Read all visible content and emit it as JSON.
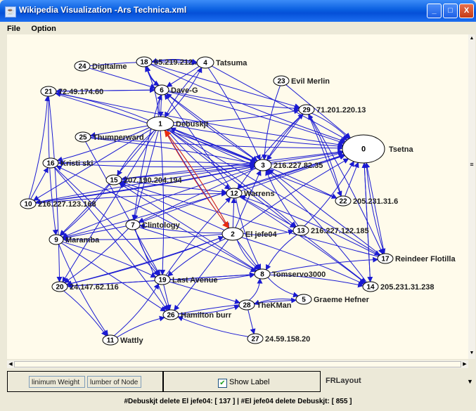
{
  "window": {
    "title": "Wikipedia Visualization -Ars Technica.xml",
    "minimize": "_",
    "maximize": "□",
    "close": "X"
  },
  "menu": [
    {
      "label": "File"
    },
    {
      "label": "Option"
    }
  ],
  "colors": {
    "edge": "#1a1ad2",
    "highlight_edge": "#e82c0e",
    "canvas": "#fffbeb"
  },
  "graph": {
    "nodes": [
      {
        "id": "0",
        "label": "Tsetna"
      },
      {
        "id": "1",
        "label": "Debuskjt"
      },
      {
        "id": "2",
        "label": "El jefe04"
      },
      {
        "id": "3",
        "label": "216.227.82.35"
      },
      {
        "id": "4",
        "label": "Tatsuma"
      },
      {
        "id": "5",
        "label": "Graeme Hefner"
      },
      {
        "id": "6",
        "label": "Dave-G"
      },
      {
        "id": "7",
        "label": "Clintology"
      },
      {
        "id": "8",
        "label": "Tomservo3000"
      },
      {
        "id": "9",
        "label": "Maramba"
      },
      {
        "id": "10",
        "label": "216.227.123.168"
      },
      {
        "id": "11",
        "label": "Wattly"
      },
      {
        "id": "12",
        "label": "Warrens"
      },
      {
        "id": "13",
        "label": "216.227.122.185"
      },
      {
        "id": "14",
        "label": "205.231.31.238"
      },
      {
        "id": "15",
        "label": "207.190.204.194"
      },
      {
        "id": "16",
        "label": "Kristi ski"
      },
      {
        "id": "17",
        "label": "Reindeer Flotilla"
      },
      {
        "id": "18",
        "label": "65.219.212.."
      },
      {
        "id": "19",
        "label": "Last Avenue"
      },
      {
        "id": "20",
        "label": "24.147.62.116"
      },
      {
        "id": "21",
        "label": "72.49.174.60"
      },
      {
        "id": "22",
        "label": "205.231.31.6"
      },
      {
        "id": "23",
        "label": "Evil Merlin"
      },
      {
        "id": "24",
        "label": "Digitalme"
      },
      {
        "id": "25",
        "label": "Thumperward"
      },
      {
        "id": "26",
        "label": "Hamilton burr"
      },
      {
        "id": "27",
        "label": "24.59.158.20"
      },
      {
        "id": "28",
        "label": "TheKMan"
      },
      {
        "id": "29",
        "label": "71.201.220.13"
      }
    ]
  },
  "controls": {
    "min_weight": "linimum Weight",
    "num_nodes": "lumber of Node",
    "show_label": "Show Label",
    "show_label_checked": true,
    "layout": "FRLayout"
  },
  "status": "#Debuskjt delete El jefe04: [ 137 ]  |  #El jefe04 delete Debuskjt: [ 855 ]"
}
